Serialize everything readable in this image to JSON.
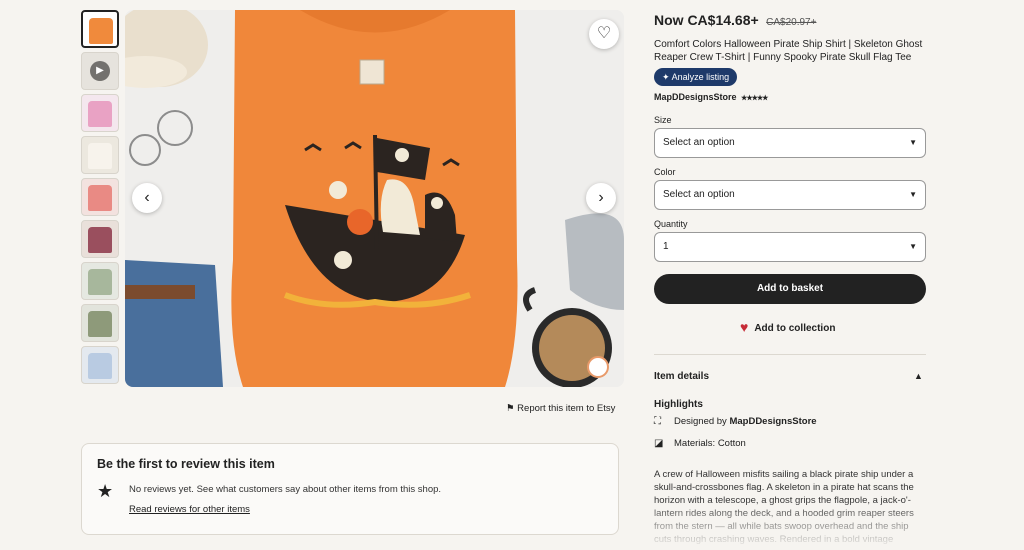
{
  "gallery": {
    "thumb_colors": [
      "#f08a3c",
      "video",
      "#e9a2c4",
      "#f3ede4",
      "#e98a84",
      "#9a4f5e",
      "#a7b79c",
      "#8e9a7a",
      "#b9cbe2"
    ]
  },
  "product": {
    "price_now": "Now CA$14.68+",
    "price_old": "CA$20.97+",
    "title": "Comfort Colors Halloween Pirate Ship Shirt | Skeleton Ghost Reaper Crew T-Shirt | Funny Spooky Pirate Skull Flag Tee",
    "analyze_label": "Analyze listing",
    "shop_name": "MapDDesignsStore",
    "stars": "★★★★★"
  },
  "options": {
    "size_label": "Size",
    "size_value": "Select an option",
    "color_label": "Color",
    "color_value": "Select an option",
    "quantity_label": "Quantity",
    "quantity_value": "1"
  },
  "actions": {
    "add_basket": "Add to basket",
    "add_collection": "Add to collection",
    "report": "Report this item to Etsy"
  },
  "reviews": {
    "title": "Be the first to review this item",
    "no_reviews": "No reviews yet. See what customers say about other items from this shop.",
    "link": "Read reviews for other items"
  },
  "details": {
    "header": "Item details",
    "highlights": "Highlights",
    "designed_by_prefix": "Designed by ",
    "designed_by_shop": "MapDDesignsStore",
    "materials": "Materials: Cotton",
    "description": "A crew of Halloween misfits sailing a black pirate ship under a skull-and-crossbones flag. A skeleton in a pirate hat scans the horizon with a telescope, a ghost grips the flagpole, a jack-o'-lantern rides along the deck, and a hooded grim reaper steers from the stern — all while bats swoop overhead and the ship cuts through crashing waves. Rendered in a bold vintage"
  }
}
